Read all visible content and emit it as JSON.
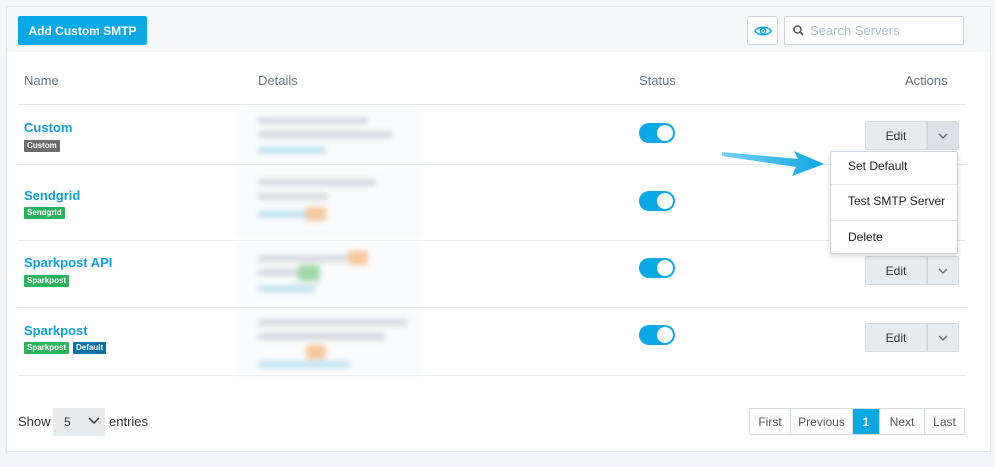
{
  "toolbar": {
    "add_button": "Add Custom SMTP",
    "search_placeholder": "Search Servers",
    "eye_icon": "eye-icon",
    "search_icon": "search-icon"
  },
  "table": {
    "headers": {
      "name": "Name",
      "details": "Details",
      "status": "Status",
      "actions": "Actions"
    },
    "rows": [
      {
        "name": "Custom",
        "tags": [
          "Custom"
        ],
        "status": "on",
        "edit": "Edit"
      },
      {
        "name": "Sendgrid",
        "tags": [
          "Sendgrid"
        ],
        "status": "on",
        "edit": "Edit"
      },
      {
        "name": "Sparkpost API",
        "tags": [
          "Sparkpost"
        ],
        "status": "on",
        "edit": "Edit"
      },
      {
        "name": "Sparkpost",
        "tags": [
          "Sparkpost",
          "Default"
        ],
        "status": "on",
        "edit": "Edit"
      }
    ]
  },
  "dropdown": {
    "items": [
      "Set Default",
      "Test SMTP Server",
      "Delete"
    ]
  },
  "footer": {
    "show": "Show",
    "entries_value": "5",
    "entries": "entries",
    "pager": [
      "First",
      "Previous",
      "1",
      "Next",
      "Last"
    ]
  },
  "colors": {
    "accent": "#0ba8e6",
    "link": "#0e9fd6",
    "tag_gray": "#6c6c6c",
    "tag_green": "#2bb35a",
    "tag_blue": "#0b6fa8"
  }
}
